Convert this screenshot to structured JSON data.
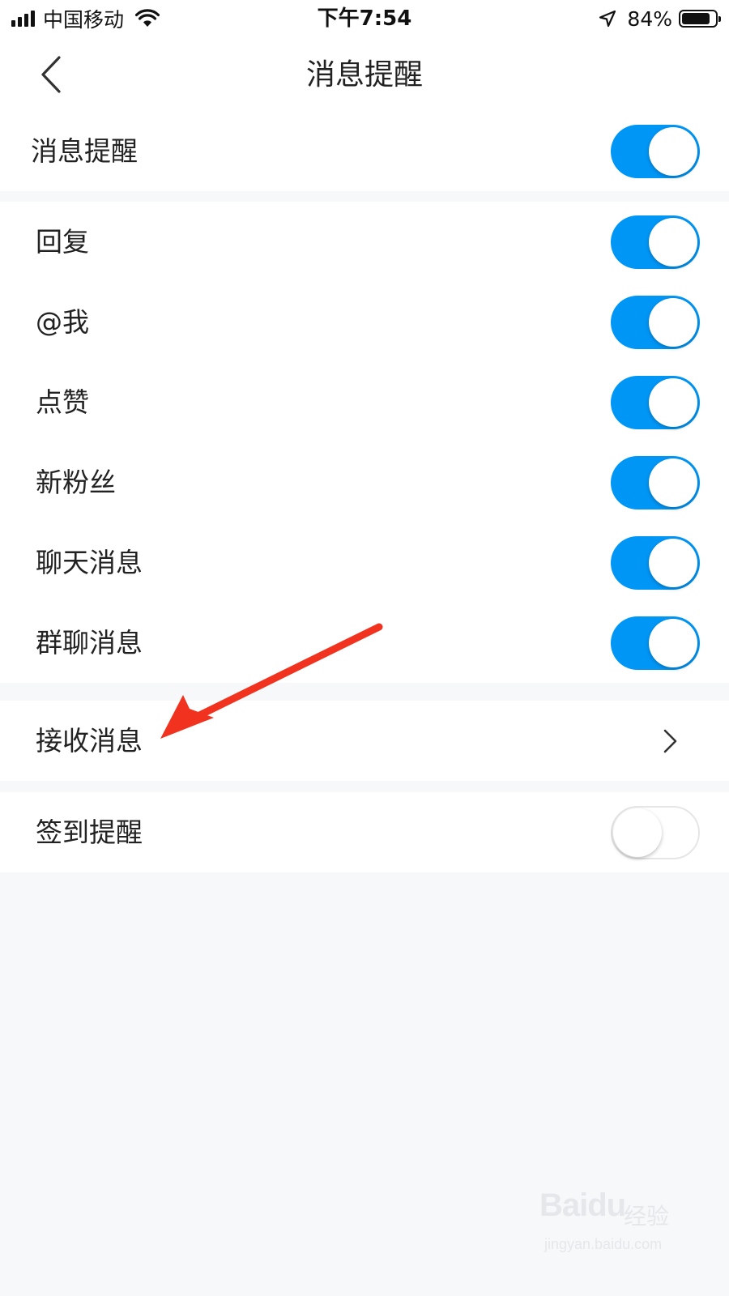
{
  "status_bar": {
    "carrier": "中国移动",
    "time": "下午7:54",
    "battery_percent": "84%",
    "battery_level": 0.84,
    "icons": [
      "signal-icon",
      "wifi-icon",
      "location-arrow-icon",
      "battery-icon"
    ]
  },
  "nav": {
    "back_icon": "chevron-left-icon",
    "title": "消息提醒"
  },
  "master": {
    "label": "消息提醒",
    "on": true
  },
  "notifications": [
    {
      "label": "回复",
      "on": true
    },
    {
      "label": "@我",
      "on": true
    },
    {
      "label": "点赞",
      "on": true
    },
    {
      "label": "新粉丝",
      "on": true
    },
    {
      "label": "聊天消息",
      "on": true
    },
    {
      "label": "群聊消息",
      "on": true
    }
  ],
  "receive": {
    "label": "接收消息",
    "icon": "chevron-right-icon"
  },
  "checkin": {
    "label": "签到提醒",
    "on": false
  },
  "annotation": {
    "color": "#f0321e",
    "icon": "red-arrow-annotation"
  },
  "watermark": {
    "logo": "Baidu",
    "brand_cn": "经验",
    "url": "jingyan.baidu.com"
  },
  "colors": {
    "toggle_on": "#0096f6",
    "toggle_off_border": "#e6e6e6",
    "page_background": "#f7f8fa"
  }
}
